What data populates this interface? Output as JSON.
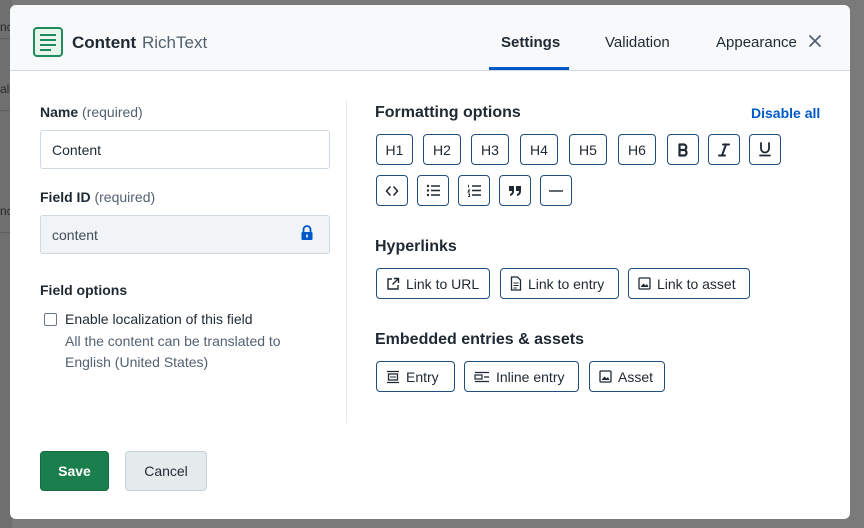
{
  "background": {
    "fragments": [
      "nc",
      "al",
      "nc"
    ]
  },
  "header": {
    "icon": "richtext-icon",
    "title": "Content",
    "subtitle": "RichText",
    "tabs": [
      {
        "label": "Settings",
        "active": true
      },
      {
        "label": "Validation",
        "active": false
      },
      {
        "label": "Appearance",
        "active": false
      }
    ],
    "close_icon": "close-icon"
  },
  "form": {
    "name": {
      "label": "Name",
      "required": "(required)",
      "value": "Content"
    },
    "field_id": {
      "label": "Field ID",
      "required": "(required)",
      "value": "content",
      "icon": "lock-icon"
    },
    "field_options": {
      "label": "Field options",
      "localization": {
        "label": "Enable localization of this field",
        "checked": false,
        "help": "All the content can be translated to English (United States)"
      }
    }
  },
  "formatting": {
    "title": "Formatting options",
    "disable_all": "Disable all",
    "headings": [
      "H1",
      "H2",
      "H3",
      "H4",
      "H5",
      "H6"
    ],
    "icon_buttons": [
      "bold-icon",
      "italic-icon",
      "underline-icon",
      "code-icon",
      "bulleted-list-icon",
      "numbered-list-icon",
      "quote-icon",
      "horizontal-rule-icon"
    ]
  },
  "hyperlinks": {
    "title": "Hyperlinks",
    "buttons": [
      {
        "label": "Link to URL",
        "icon": "external-link-icon"
      },
      {
        "label": "Link to entry",
        "icon": "entry-icon"
      },
      {
        "label": "Link to asset",
        "icon": "asset-icon"
      }
    ]
  },
  "embedded": {
    "title": "Embedded entries & assets",
    "buttons": [
      {
        "label": "Entry",
        "icon": "embedded-entry-icon"
      },
      {
        "label": "Inline entry",
        "icon": "inline-entry-icon"
      },
      {
        "label": "Asset",
        "icon": "asset-icon"
      }
    ]
  },
  "footer": {
    "save": "Save",
    "cancel": "Cancel"
  },
  "colors": {
    "primary": "#0059c8",
    "save": "#1a7f4d",
    "border": "#1f4e80"
  }
}
